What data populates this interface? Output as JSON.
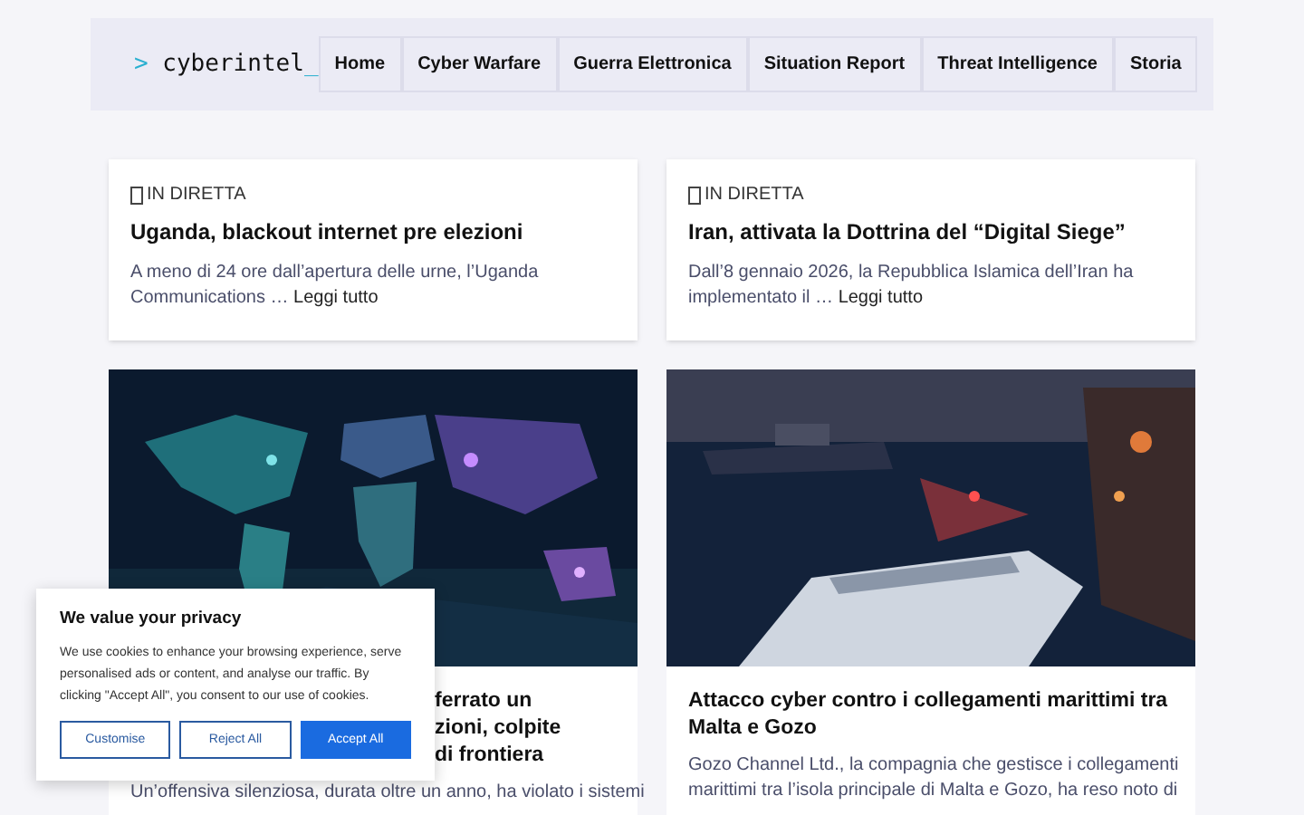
{
  "header": {
    "logo": {
      "prompt": ">",
      "name": "cyberintel",
      "cursor": "_"
    },
    "nav": [
      {
        "label": "Home"
      },
      {
        "label": "Cyber Warfare"
      },
      {
        "label": "Guerra Elettronica"
      },
      {
        "label": "Situation Report"
      },
      {
        "label": "Threat Intelligence"
      },
      {
        "label": "Storia"
      }
    ]
  },
  "live_cards": [
    {
      "badge": "IN DIRETTA",
      "title": "Uganda, blackout internet pre elezioni",
      "excerpt": "A meno di 24 ore dall’apertura delle urne, l’Uganda Communications …",
      "link": "Leggi tutto"
    },
    {
      "badge": "IN DIRETTA",
      "title": "Iran, attivata la Dottrina del “Digital Siege”",
      "excerpt": "Dall’8 gennaio 2026, la Repubblica Islamica dell’Iran ha implementato il …",
      "link": "Leggi tutto"
    }
  ],
  "articles": [
    {
      "picture": {
        "kind": "picture"
      },
      "title_lines": [
        "ferrato un",
        "zioni, colpite",
        "di frontiera"
      ],
      "excerpt_lines": [
        "Un’offensiva silenziosa, durata oltre un anno, ha violato i sistemi"
      ]
    },
    {
      "picture": {
        "kind": "picture"
      },
      "title_lines": [
        "Attacco cyber contro i collegamenti marittimi tra",
        "Malta e Gozo"
      ],
      "excerpt_lines": [
        "Gozo Channel Ltd., la compagnia che gestisce i collegamenti",
        "marittimi tra l’isola principale di Malta e Gozo, ha reso noto di"
      ]
    }
  ],
  "cookie_banner": {
    "title": "We value your privacy",
    "text": "We use cookies to enhance your browsing experience, serve personalised ads or content, and analyse our traffic. By clicking \"Accept All\", you consent to our use of cookies.",
    "buttons": [
      {
        "label": "Customise",
        "kind": "outline"
      },
      {
        "label": "Reject All",
        "kind": "outline"
      },
      {
        "label": "Accept All",
        "kind": "primary"
      }
    ]
  }
}
